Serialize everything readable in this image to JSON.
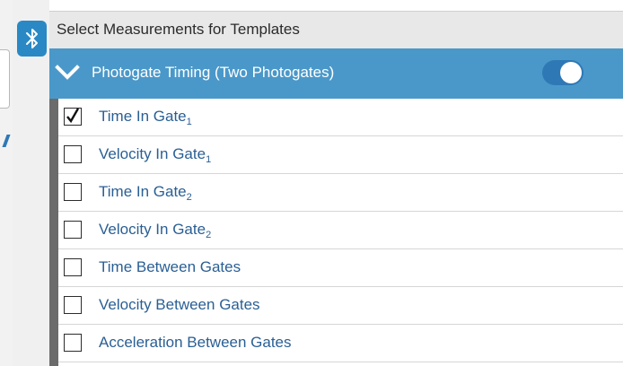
{
  "panel": {
    "title": "Select Measurements for Templates"
  },
  "group": {
    "title": "Photogate Timing (Two Photogates)",
    "enabled": true
  },
  "items": [
    {
      "label": "Time In Gate",
      "sub": "1",
      "checked": true
    },
    {
      "label": "Velocity In Gate",
      "sub": "1",
      "checked": false
    },
    {
      "label": "Time In Gate",
      "sub": "2",
      "checked": false
    },
    {
      "label": "Velocity In Gate",
      "sub": "2",
      "checked": false
    },
    {
      "label": "Time Between Gates",
      "sub": "",
      "checked": false
    },
    {
      "label": "Velocity Between Gates",
      "sub": "",
      "checked": false
    },
    {
      "label": "Acceleration Between Gates",
      "sub": "",
      "checked": false
    }
  ],
  "icons": {
    "bluetooth": "bluetooth-icon",
    "chevron": "chevron-down-icon",
    "check": "checkmark-icon"
  },
  "colors": {
    "header_bg": "#e8e8e8",
    "group_bg": "#4a98c9",
    "toggle_on": "#2f78b6",
    "label_text": "#2a5f94",
    "bluetooth_bg": "#2a89c4"
  }
}
